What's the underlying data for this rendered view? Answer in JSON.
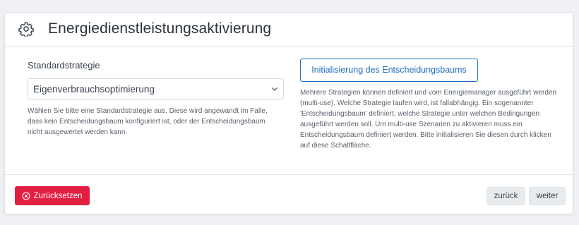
{
  "header": {
    "title": "Energiedienstleistungsaktivierung",
    "icon": "gear-icon"
  },
  "left": {
    "label": "Standardstrategie",
    "select_value": "Eigenverbrauchsoptimierung",
    "help": "Wählen Sie bitte eine Standardstrategie aus. Diese wird angewandt im Falle, dass kein Entscheidungsbaum konfiguriert ist, oder der Entscheidungsbaum nicht ausgewertet werden kann."
  },
  "right": {
    "init_button": "Initialisierung des Entscheidungsbaums",
    "help": "Mehrere Strategien können definiert und vom Energiemanager ausgeführt werden (multi-use). Welche Strategie laufen wird, ist fallabhängig. Ein sogenannter 'Entscheidungsbaum' definiert, welche Strategie unter welchen Bedingungen ausgeführt werden soll. Um multi-use Szenarien zu aktivieren muss ein Entscheidungsbaum definiert werden. Bitte initialisieren Sie diesen durch klicken auf diese Schaltfläche."
  },
  "footer": {
    "reset_label": "Zurücksetzen",
    "back_label": "zurück",
    "next_label": "weiter"
  },
  "colors": {
    "accent": "#1f6fc0",
    "danger": "#e21f41"
  }
}
